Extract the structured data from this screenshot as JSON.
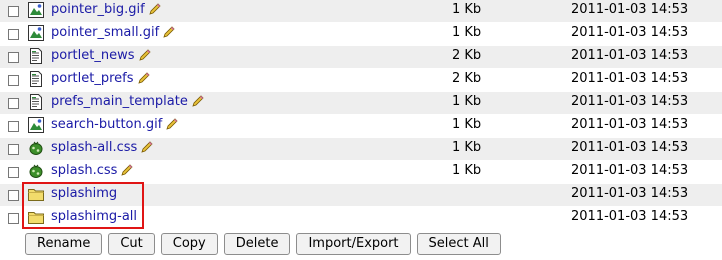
{
  "files": [
    {
      "name": "pointer_big.gif",
      "type": "image",
      "size": "1 Kb",
      "date": "2011-01-03 14:53"
    },
    {
      "name": "pointer_small.gif",
      "type": "image",
      "size": "1 Kb",
      "date": "2011-01-03 14:53"
    },
    {
      "name": "portlet_news",
      "type": "page-template",
      "size": "2 Kb",
      "date": "2011-01-03 14:53"
    },
    {
      "name": "portlet_prefs",
      "type": "page-template",
      "size": "2 Kb",
      "date": "2011-01-03 14:53"
    },
    {
      "name": "prefs_main_template",
      "type": "page-template",
      "size": "1 Kb",
      "date": "2011-01-03 14:53"
    },
    {
      "name": "search-button.gif",
      "type": "image",
      "size": "1 Kb",
      "date": "2011-01-03 14:53"
    },
    {
      "name": "splash-all.css",
      "type": "dtml",
      "size": "1 Kb",
      "date": "2011-01-03 14:53"
    },
    {
      "name": "splash.css",
      "type": "dtml",
      "size": "1 Kb",
      "date": "2011-01-03 14:53"
    },
    {
      "name": "splashimg",
      "type": "folder",
      "size": "",
      "date": "2011-01-03 14:53"
    },
    {
      "name": "splashimg-all",
      "type": "folder",
      "size": "",
      "date": "2011-01-03 14:53"
    }
  ],
  "toolbar": {
    "rename": "Rename",
    "cut": "Cut",
    "copy": "Copy",
    "delete": "Delete",
    "import_export": "Import/Export",
    "select_all": "Select All"
  },
  "colors": {
    "link": "#1a1aa6",
    "row_shade": "#eeeeee",
    "highlight_border": "#e01515",
    "folder": "#f2dc6b"
  }
}
